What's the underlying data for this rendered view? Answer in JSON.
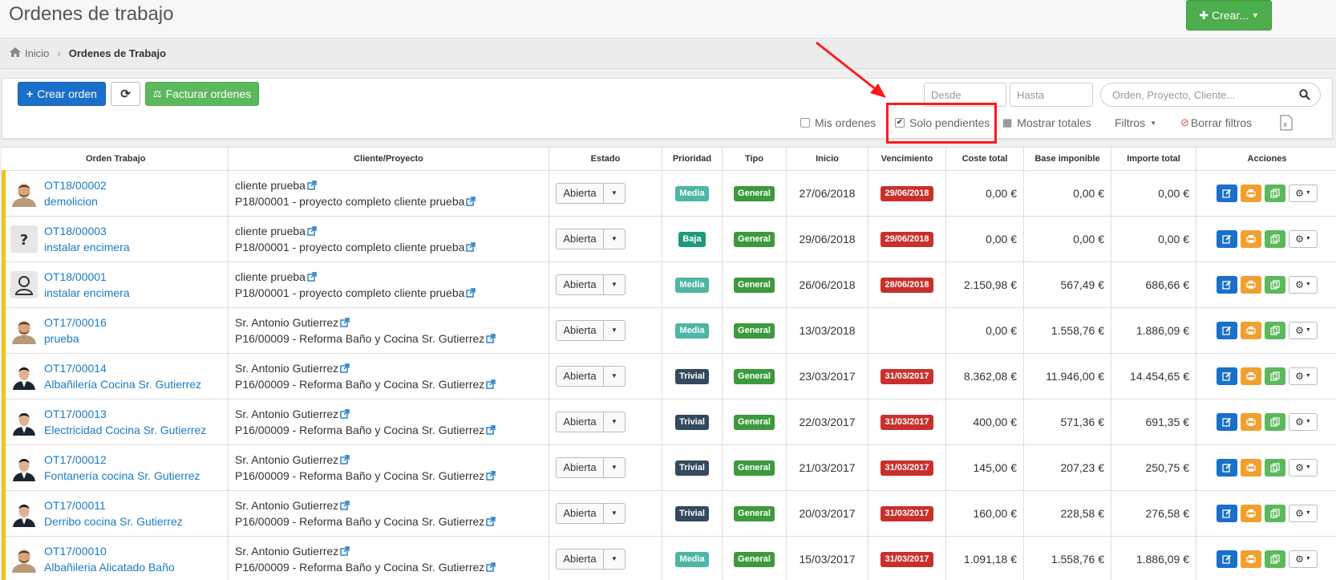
{
  "header": {
    "title": "Ordenes de trabajo",
    "create_label": "Crear...",
    "colors": {
      "primary": "#1a6fc9",
      "success": "#5cb85c",
      "danger": "#c9302c",
      "highlight": "#ff1a1a"
    }
  },
  "breadcrumb": {
    "home": "Inicio",
    "current": "Ordenes de Trabajo"
  },
  "toolbar": {
    "create_order": "Crear orden",
    "invoice_orders": "Facturar ordenes",
    "desde_placeholder": "Desde",
    "hasta_placeholder": "Hasta",
    "search_placeholder": "Orden, Proyecto, Cliente...",
    "mis_ordenes": "Mis ordenes",
    "mis_ordenes_checked": false,
    "solo_pendientes": "Solo pendientes",
    "solo_pendientes_checked": true,
    "mostrar_totales": "Mostrar totales",
    "filtros": "Filtros",
    "borrar_filtros": "Borrar filtros"
  },
  "table": {
    "headers": {
      "orden": "Orden Trabajo",
      "cliente": "Cliente/Proyecto",
      "estado": "Estado",
      "prioridad": "Prioridad",
      "tipo": "Tipo",
      "inicio": "Inicio",
      "vencimiento": "Vencimiento",
      "coste": "Coste total",
      "base": "Base imponible",
      "importe": "Importe total",
      "acciones": "Acciones"
    },
    "rows": [
      {
        "avatar": "man-beard",
        "code": "OT18/00002",
        "name": "demolicion",
        "client": "cliente prueba",
        "project": "P18/00001 - proyecto completo cliente prueba",
        "estado": "Abierta",
        "prioridad": "Media",
        "tipo": "General",
        "inicio": "27/06/2018",
        "vencimiento": "29/06/2018",
        "coste": "0,00 €",
        "base": "0,00 €",
        "importe": "0,00 €"
      },
      {
        "avatar": "unknown",
        "code": "OT18/00003",
        "name": "instalar encimera",
        "client": "cliente prueba",
        "project": "P18/00001 - proyecto completo cliente prueba",
        "estado": "Abierta",
        "prioridad": "Baja",
        "tipo": "General",
        "inicio": "29/06/2018",
        "vencimiento": "29/06/2018",
        "coste": "0,00 €",
        "base": "0,00 €",
        "importe": "0,00 €"
      },
      {
        "avatar": "generic-user",
        "code": "OT18/00001",
        "name": "instalar encimera",
        "client": "cliente prueba",
        "project": "P18/00001 - proyecto completo cliente prueba",
        "estado": "Abierta",
        "prioridad": "Media",
        "tipo": "General",
        "inicio": "26/06/2018",
        "vencimiento": "28/06/2018",
        "coste": "2.150,98 €",
        "base": "567,49 €",
        "importe": "686,66 €"
      },
      {
        "avatar": "man-beard",
        "code": "OT17/00016",
        "name": "prueba",
        "client": "Sr. Antonio Gutierrez",
        "project": "P16/00009 - Reforma Baño y Cocina Sr. Gutierrez",
        "estado": "Abierta",
        "prioridad": "Media",
        "tipo": "General",
        "inicio": "13/03/2018",
        "vencimiento": "",
        "coste": "0,00 €",
        "base": "1.558,76 €",
        "importe": "1.886,09 €"
      },
      {
        "avatar": "man-suit",
        "code": "OT17/00014",
        "name": "Albañilería Cocina Sr. Gutierrez",
        "client": "Sr. Antonio Gutierrez",
        "project": "P16/00009 - Reforma Baño y Cocina Sr. Gutierrez",
        "estado": "Abierta",
        "prioridad": "Trivial",
        "tipo": "General",
        "inicio": "23/03/2017",
        "vencimiento": "31/03/2017",
        "coste": "8.362,08 €",
        "base": "11.946,00 €",
        "importe": "14.454,65 €"
      },
      {
        "avatar": "man-suit",
        "code": "OT17/00013",
        "name": "Electricidad Cocina Sr. Gutierrez",
        "client": "Sr. Antonio Gutierrez",
        "project": "P16/00009 - Reforma Baño y Cocina Sr. Gutierrez",
        "estado": "Abierta",
        "prioridad": "Trivial",
        "tipo": "General",
        "inicio": "22/03/2017",
        "vencimiento": "31/03/2017",
        "coste": "400,00 €",
        "base": "571,36 €",
        "importe": "691,35 €"
      },
      {
        "avatar": "man-suit",
        "code": "OT17/00012",
        "name": "Fontanería cocina Sr. Gutierrez",
        "client": "Sr. Antonio Gutierrez",
        "project": "P16/00009 - Reforma Baño y Cocina Sr. Gutierrez",
        "estado": "Abierta",
        "prioridad": "Trivial",
        "tipo": "General",
        "inicio": "21/03/2017",
        "vencimiento": "31/03/2017",
        "coste": "145,00 €",
        "base": "207,23 €",
        "importe": "250,75 €"
      },
      {
        "avatar": "man-suit",
        "code": "OT17/00011",
        "name": "Derribo cocina Sr. Gutierrez",
        "client": "Sr. Antonio Gutierrez",
        "project": "P16/00009 - Reforma Baño y Cocina Sr. Gutierrez",
        "estado": "Abierta",
        "prioridad": "Trivial",
        "tipo": "General",
        "inicio": "20/03/2017",
        "vencimiento": "31/03/2017",
        "coste": "160,00 €",
        "base": "228,58 €",
        "importe": "276,58 €"
      },
      {
        "avatar": "man-beard",
        "code": "OT17/00010",
        "name": "Albañileria Alicatado Baño",
        "client": "Sr. Antonio Gutierrez",
        "project": "P16/00009 - Reforma Baño y Cocina Sr. Gutierrez",
        "estado": "Abierta",
        "prioridad": "Media",
        "tipo": "General",
        "inicio": "15/03/2017",
        "vencimiento": "31/03/2017",
        "coste": "1.091,18 €",
        "base": "1.558,76 €",
        "importe": "1.886,09 €"
      }
    ],
    "priority_colors": {
      "Media": "#4db6a5",
      "Baja": "#1e9a7a",
      "Trivial": "#34495e"
    },
    "tipo_color": "#3c9a3c",
    "vencimiento_color": "#c9302c"
  }
}
